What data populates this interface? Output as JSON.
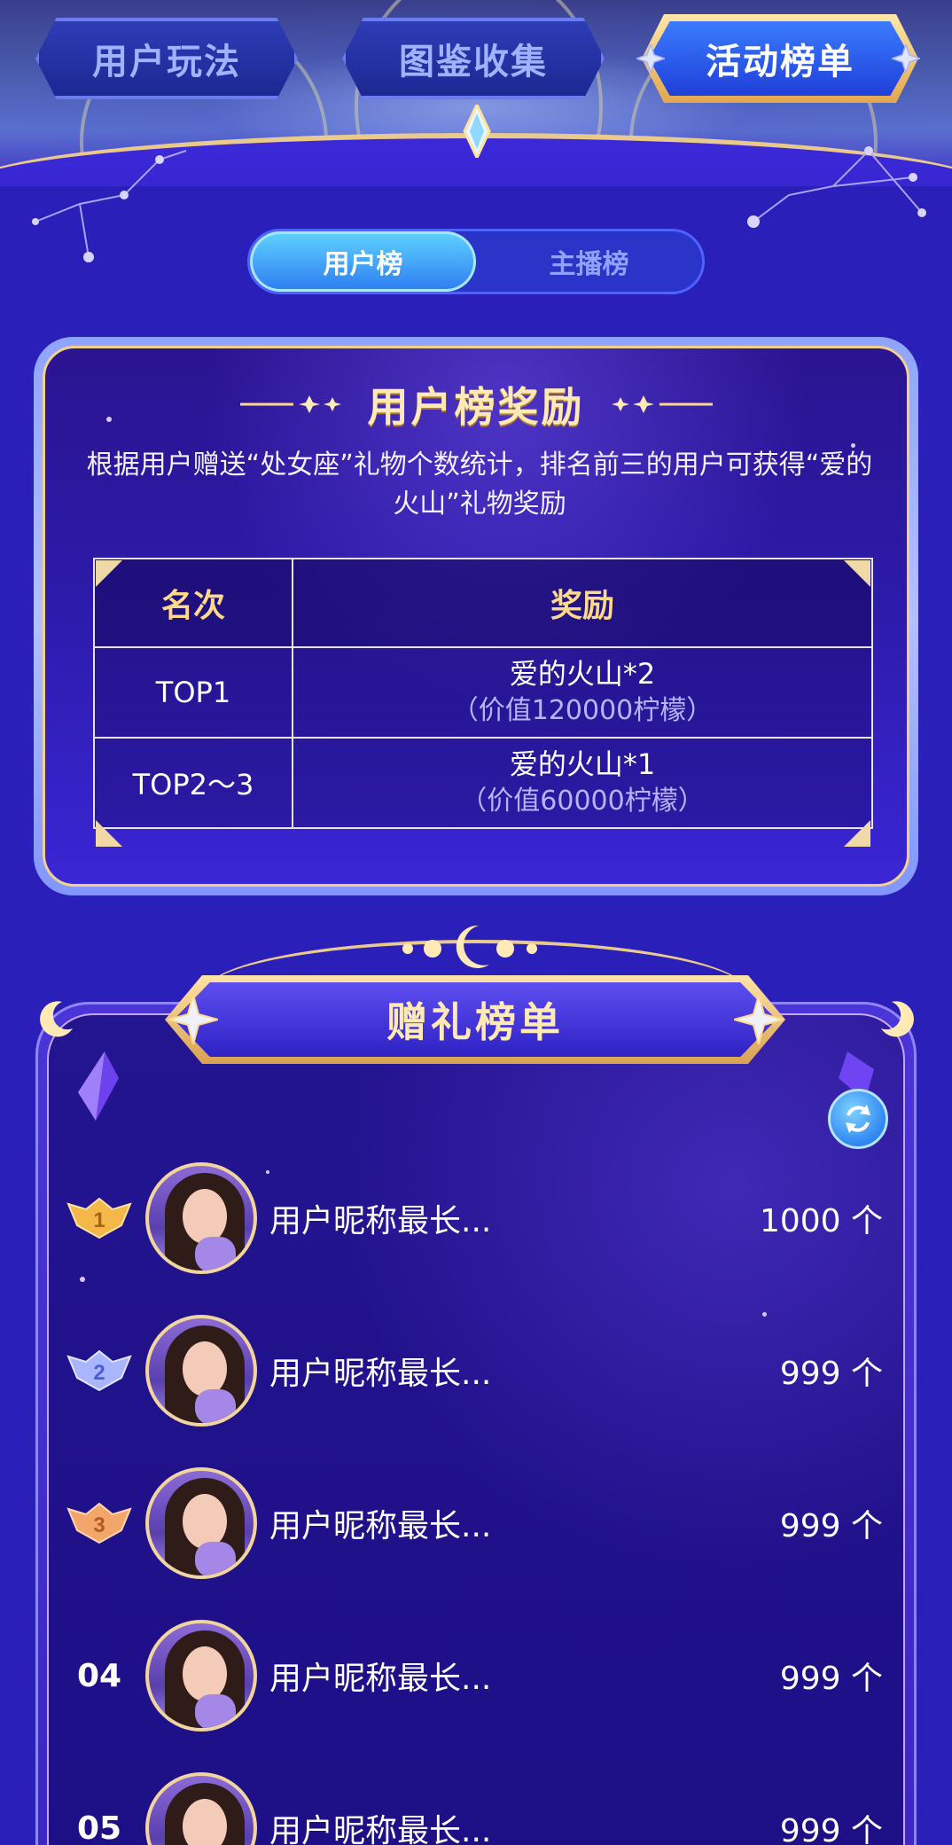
{
  "main_tabs": [
    {
      "label": "用户玩法"
    },
    {
      "label": "图鉴收集"
    },
    {
      "label": "活动榜单"
    }
  ],
  "sub_tabs": [
    {
      "label": "用户榜"
    },
    {
      "label": "主播榜"
    }
  ],
  "reward": {
    "title": "用户榜奖励",
    "description": "根据用户赠送“处女座”礼物个数统计，排名前三的用户可获得“爱的火山”礼物奖励",
    "table": {
      "headers": [
        "名次",
        "奖励"
      ],
      "rows": [
        {
          "rank": "TOP1",
          "prize": "爱的火山*2",
          "value": "（价值120000柠檬）"
        },
        {
          "rank": "TOP2～3",
          "prize": "爱的火山*1",
          "value": "（价值60000柠檬）"
        }
      ]
    }
  },
  "ranking": {
    "title": "赠礼榜单",
    "refresh_icon": "refresh-icon",
    "rows": [
      {
        "rank": "1",
        "nickname": "用户昵称最长...",
        "count": "1000 个"
      },
      {
        "rank": "2",
        "nickname": "用户昵称最长...",
        "count": "999 个"
      },
      {
        "rank": "3",
        "nickname": "用户昵称最长...",
        "count": "999 个"
      },
      {
        "rank": "04",
        "nickname": "用户昵称最长...",
        "count": "999 个"
      },
      {
        "rank": "05",
        "nickname": "用户昵称最长...",
        "count": "999 个"
      }
    ]
  },
  "colors": {
    "background": "#2a1fb8",
    "gold": "#ffe9b5",
    "active_tab": "#2f86f2"
  }
}
